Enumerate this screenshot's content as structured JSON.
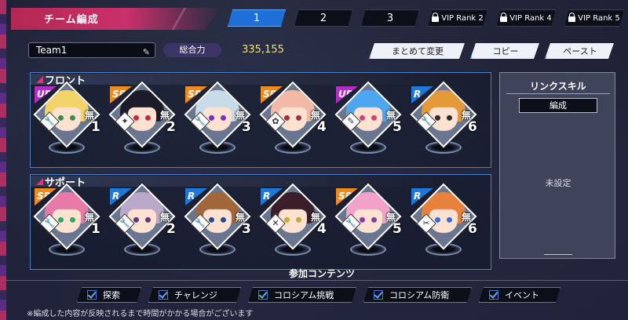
{
  "header": {
    "title": "チーム編成",
    "tabs": [
      {
        "label": "1",
        "active": true
      },
      {
        "label": "2",
        "active": false
      },
      {
        "label": "3",
        "active": false
      }
    ],
    "locked_tabs": [
      {
        "label": "VIP Rank 2"
      },
      {
        "label": "VIP Rank 4"
      },
      {
        "label": "VIP Rank 5"
      }
    ]
  },
  "team": {
    "name": "Team1",
    "power_label": "総合力",
    "power_value": "335,155"
  },
  "actions": {
    "bulk_change": "まとめて変更",
    "copy": "コピー",
    "paste": "ペースト"
  },
  "front": {
    "label": "フロント",
    "slots": [
      {
        "rarity": "UR",
        "attribute": "無",
        "number": "1",
        "hair": "#f3d46b",
        "eye": "#3a8e4a",
        "weapon": "🔧"
      },
      {
        "rarity": "SR",
        "attribute": "無",
        "number": "2",
        "hair": "#1b1b2a",
        "eye": "#c42a4a",
        "weapon": "✦"
      },
      {
        "rarity": "SR",
        "attribute": "無",
        "number": "3",
        "hair": "#c8dbe8",
        "eye": "#7a2ec4",
        "weapon": "🔧"
      },
      {
        "rarity": "SR",
        "attribute": "無",
        "number": "4",
        "hair": "#f2b9a6",
        "eye": "#a13040",
        "weapon": "✿"
      },
      {
        "rarity": "UR",
        "attribute": "無",
        "number": "5",
        "hair": "#4fa6f0",
        "eye": "#d0407a",
        "weapon": "✎"
      },
      {
        "rarity": "R",
        "attribute": "無",
        "number": "6",
        "hair": "#e59a3a",
        "eye": "#2c2c2c",
        "weapon": "🔧"
      }
    ]
  },
  "support": {
    "label": "サポート",
    "slots": [
      {
        "rarity": "SR",
        "attribute": "無",
        "number": "1",
        "hair": "#e87aa8",
        "eye": "#2fa86a",
        "weapon": "🔧"
      },
      {
        "rarity": "R",
        "attribute": "無",
        "number": "2",
        "hair": "#b9a8c8",
        "eye": "#5a3a7a",
        "weapon": "🔧"
      },
      {
        "rarity": "R",
        "attribute": "無",
        "number": "3",
        "hair": "#a0683a",
        "eye": "#2a4a8a",
        "weapon": "🔧"
      },
      {
        "rarity": "R",
        "attribute": "無",
        "number": "4",
        "hair": "#3a1f2a",
        "eye": "#c8a83a",
        "weapon": "✕"
      },
      {
        "rarity": "SR",
        "attribute": "無",
        "number": "5",
        "hair": "#f2a2c8",
        "eye": "#8a3aa8",
        "weapon": "🔧"
      },
      {
        "rarity": "R",
        "attribute": "無",
        "number": "6",
        "hair": "#e8823a",
        "eye": "#3a6ad8",
        "weapon": "✂"
      }
    ]
  },
  "link_skill": {
    "title": "リンクスキル",
    "button": "編成",
    "empty": "未設定"
  },
  "contents": {
    "title": "参加コンテンツ",
    "items": [
      "探索",
      "チャレンジ",
      "コロシアム挑戦",
      "コロシアム防衛",
      "イベント"
    ]
  },
  "footnote": "※編成した内容が反映されるまで時間がかかる場合がございます",
  "colors": {
    "accent_pink": "#c8316a",
    "active_tab": "#1f6fd8",
    "power_value": "#f3e36a",
    "rarity_UR": "#b62cc8",
    "rarity_SR": "#f08a1e",
    "rarity_R": "#1f78d8"
  }
}
